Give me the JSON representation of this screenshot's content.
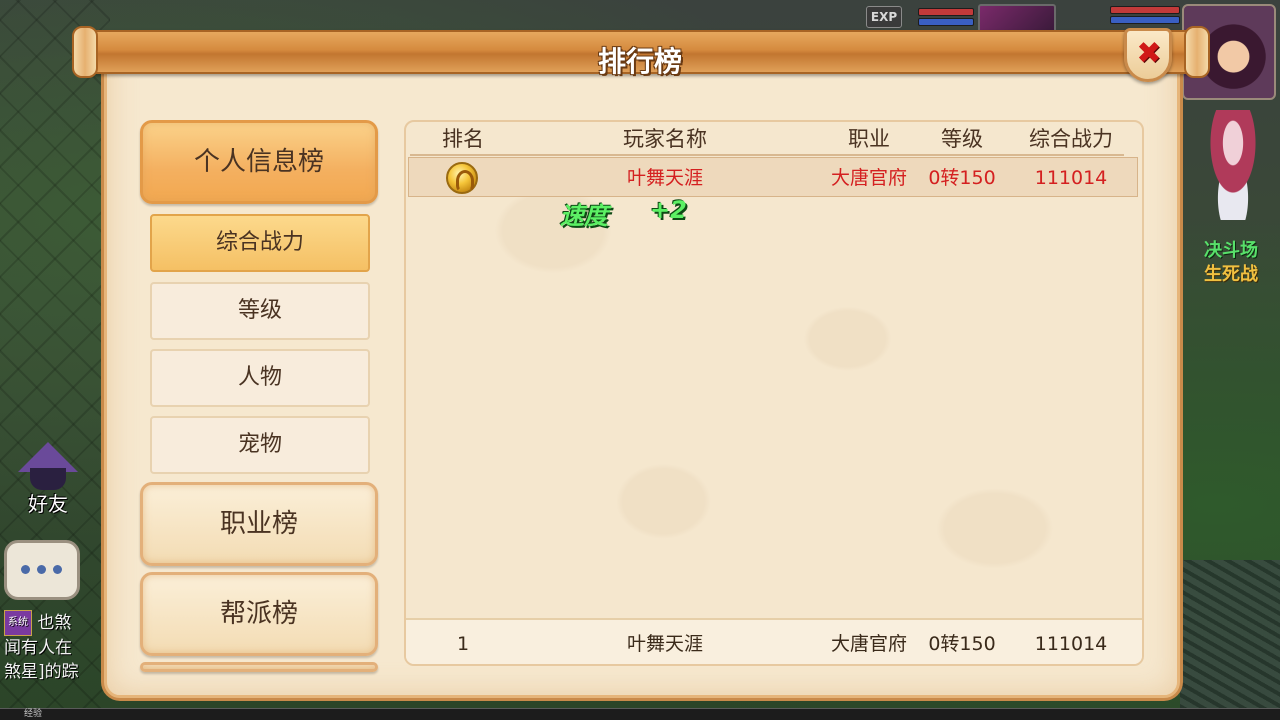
{
  "window": {
    "title": "排行榜"
  },
  "hud": {
    "exp_badge": "EXP",
    "side_event_1": "决斗场",
    "side_event_2": "生死战",
    "friends_label": "好友",
    "chat_tag": "系统",
    "chat_lines": [
      "也煞",
      "闻有人在",
      "煞星]的踪"
    ],
    "exp_strip_label": "经验"
  },
  "nav": {
    "personal": "个人信息榜",
    "sub_items": [
      "综合战力",
      "等级",
      "人物",
      "宠物"
    ],
    "job": "职业榜",
    "guild": "帮派榜",
    "active_main": "个人信息榜",
    "active_sub": "综合战力"
  },
  "table": {
    "columns": [
      "排名",
      "玩家名称",
      "职业",
      "等级",
      "综合战力"
    ],
    "rows": [
      {
        "rank_icon": "gold-medal-icon",
        "name": "叶舞天涯",
        "job": "大唐官府",
        "level": "0转150",
        "power": "111014"
      }
    ],
    "self_row": {
      "rank": "1",
      "name": "叶舞天涯",
      "job": "大唐官府",
      "level": "0转150",
      "power": "111014"
    }
  },
  "floating_text": {
    "label": "速度",
    "value": "+2"
  },
  "colors": {
    "highlight_text": "#d42020",
    "panel_bg": "#f5e7ce",
    "frame_orange": "#e39a48",
    "buff_green": "#5cf064"
  }
}
